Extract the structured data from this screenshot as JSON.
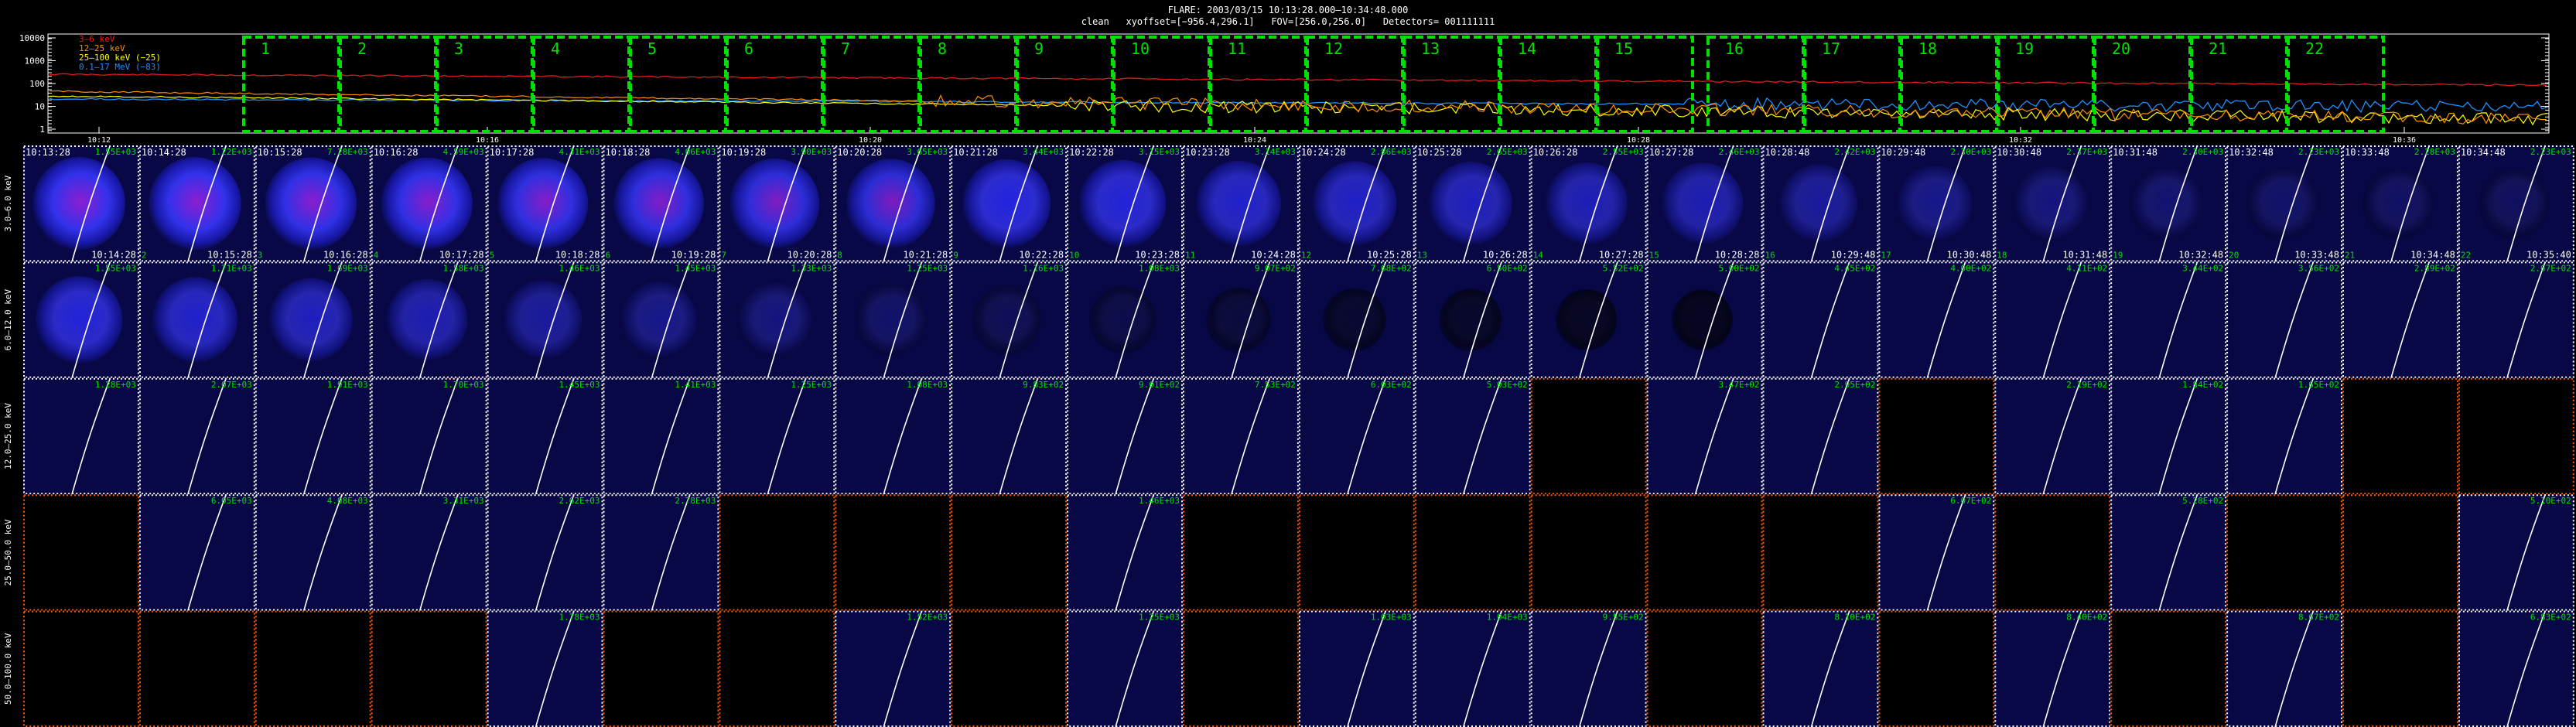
{
  "header": {
    "line1": "FLARE: 2003/03/15 10:13:28.000–10:34:48.000",
    "line2": "clean   xyoffset=[−956.4,296.1]   FOV=[256.0,256.0]   Detectors= 001111111"
  },
  "lightcurve": {
    "yticks": [
      "10000",
      "1000",
      "100",
      "10",
      "1"
    ],
    "xticks": [
      "10:12",
      "10:16",
      "10:20",
      "10:24",
      "10:28",
      "10:32",
      "10:36"
    ],
    "legend": [
      {
        "label": "3–6 keV",
        "color": "#e31a1a"
      },
      {
        "label": "12–25 keV",
        "color": "#ff8c00"
      },
      {
        "label": "25–100 keV (−25)",
        "color": "#ffff00"
      },
      {
        "label": "0.1–17 MeV (−83)",
        "color": "#1e90ff"
      }
    ],
    "intervals": [
      "1",
      "2",
      "3",
      "4",
      "5",
      "6",
      "7",
      "8",
      "9",
      "10",
      "11",
      "12",
      "13",
      "14",
      "15",
      "16",
      "17",
      "18",
      "19",
      "20",
      "21",
      "22"
    ],
    "colors": {
      "box": "#00e000",
      "red": "#e31a1a",
      "orange": "#ff8c00",
      "yellow": "#ffff00",
      "blue": "#1e90ff"
    }
  },
  "rows": [
    {
      "label": "3.0–6.0 keV",
      "cells": [
        {
          "start": "10:13:28",
          "end": "10:14:28",
          "value": "1.55E+03",
          "num": "",
          "brightness": 1.0,
          "purple": 1,
          "frame": "white"
        },
        {
          "start": "10:14:28",
          "end": "10:15:28",
          "value": "1.22E+03",
          "num": "2",
          "brightness": 1.0,
          "purple": 1,
          "frame": "white"
        },
        {
          "start": "10:15:28",
          "end": "10:16:28",
          "value": "7.28E+03",
          "num": "3",
          "brightness": 0.98,
          "purple": 1,
          "frame": "white"
        },
        {
          "start": "10:16:28",
          "end": "10:17:28",
          "value": "4.59E+03",
          "num": "4",
          "brightness": 0.97,
          "purple": 1,
          "frame": "white"
        },
        {
          "start": "10:17:28",
          "end": "10:18:28",
          "value": "4.31E+03",
          "num": "5",
          "brightness": 0.95,
          "purple": 1,
          "frame": "white"
        },
        {
          "start": "10:18:28",
          "end": "10:19:28",
          "value": "4.06E+03",
          "num": "6",
          "brightness": 0.94,
          "purple": 1,
          "frame": "white"
        },
        {
          "start": "10:19:28",
          "end": "10:20:28",
          "value": "3.90E+03",
          "num": "7",
          "brightness": 0.92,
          "purple": 1,
          "frame": "white"
        },
        {
          "start": "10:20:28",
          "end": "10:21:28",
          "value": "3.65E+03",
          "num": "8",
          "brightness": 0.9,
          "purple": 1,
          "frame": "white"
        },
        {
          "start": "10:21:28",
          "end": "10:22:28",
          "value": "3.44E+03",
          "num": "9",
          "brightness": 0.88,
          "purple": 0,
          "frame": "white"
        },
        {
          "start": "10:22:28",
          "end": "10:23:28",
          "value": "3.15E+03",
          "num": "10",
          "brightness": 0.85,
          "purple": 0,
          "frame": "white"
        },
        {
          "start": "10:23:28",
          "end": "10:24:28",
          "value": "3.14E+03",
          "num": "11",
          "brightness": 0.8,
          "purple": 0,
          "frame": "white"
        },
        {
          "start": "10:24:28",
          "end": "10:25:28",
          "value": "2.86E+03",
          "num": "12",
          "brightness": 0.78,
          "purple": 0,
          "frame": "white"
        },
        {
          "start": "10:25:28",
          "end": "10:26:28",
          "value": "2.65E+03",
          "num": "13",
          "brightness": 0.75,
          "purple": 0,
          "frame": "white"
        },
        {
          "start": "10:26:28",
          "end": "10:27:28",
          "value": "2.55E+03",
          "num": "14",
          "brightness": 0.72,
          "purple": 0,
          "frame": "white"
        },
        {
          "start": "10:27:28",
          "end": "10:28:28",
          "value": "2.46E+03",
          "num": "15",
          "brightness": 0.7,
          "purple": 0,
          "frame": "white"
        },
        {
          "start": "10:28:48",
          "end": "10:29:48",
          "value": "2.42E+03",
          "num": "16",
          "brightness": 0.62,
          "purple": 0,
          "frame": "white"
        },
        {
          "start": "10:29:48",
          "end": "10:30:48",
          "value": "2.30E+03",
          "num": "17",
          "brightness": 0.55,
          "purple": 0,
          "frame": "white"
        },
        {
          "start": "10:30:48",
          "end": "10:31:48",
          "value": "2.37E+03",
          "num": "18",
          "brightness": 0.5,
          "purple": 0,
          "frame": "white"
        },
        {
          "start": "10:31:48",
          "end": "10:32:48",
          "value": "2.30E+03",
          "num": "19",
          "brightness": 0.45,
          "purple": 0,
          "frame": "white"
        },
        {
          "start": "10:32:48",
          "end": "10:33:48",
          "value": "2.23E+03",
          "num": "20",
          "brightness": 0.42,
          "purple": 0,
          "frame": "white"
        },
        {
          "start": "10:33:48",
          "end": "10:34:48",
          "value": "2.28E+03",
          "num": "21",
          "brightness": 0.4,
          "purple": 0,
          "frame": "white"
        },
        {
          "start": "10:34:48",
          "end": "10:35:40",
          "value": "2.23E+03",
          "num": "22",
          "brightness": 0.38,
          "purple": 0,
          "frame": "white"
        }
      ]
    },
    {
      "label": "6.0–12.0 keV",
      "cells": [
        {
          "value": "1.55E+03",
          "brightness": 0.85,
          "frame": "white"
        },
        {
          "value": "1.71E+03",
          "brightness": 0.8,
          "frame": "white"
        },
        {
          "value": "1.69E+03",
          "brightness": 0.75,
          "frame": "white"
        },
        {
          "value": "1.58E+03",
          "brightness": 0.7,
          "frame": "white"
        },
        {
          "value": "1.46E+03",
          "brightness": 0.62,
          "frame": "white"
        },
        {
          "value": "1.45E+03",
          "brightness": 0.55,
          "frame": "white"
        },
        {
          "value": "1.33E+03",
          "brightness": 0.5,
          "frame": "white"
        },
        {
          "value": "1.25E+03",
          "brightness": 0.42,
          "frame": "white"
        },
        {
          "value": "1.16E+03",
          "brightness": 0.35,
          "frame": "white"
        },
        {
          "value": "1.08E+03",
          "brightness": 0.3,
          "frame": "white"
        },
        {
          "value": "9.07E+02",
          "brightness": 0.25,
          "frame": "white"
        },
        {
          "value": "7.68E+02",
          "brightness": 0.2,
          "frame": "white"
        },
        {
          "value": "6.50E+02",
          "brightness": 0.18,
          "frame": "white"
        },
        {
          "value": "5.52E+02",
          "brightness": 0.15,
          "frame": "white"
        },
        {
          "value": "5.00E+02",
          "brightness": 0.14,
          "frame": "white"
        },
        {
          "value": "4.45E+02",
          "brightness": 0.13,
          "frame": "white"
        },
        {
          "value": "4.00E+02",
          "brightness": 0.12,
          "frame": "white"
        },
        {
          "value": "4.11E+02",
          "brightness": 0.12,
          "frame": "white"
        },
        {
          "value": "3.44E+02",
          "brightness": 0.11,
          "frame": "white"
        },
        {
          "value": "3.56E+02",
          "brightness": 0.11,
          "frame": "white"
        },
        {
          "value": "2.89E+02",
          "brightness": 0.1,
          "frame": "white"
        },
        {
          "value": "2.67E+02",
          "brightness": 0.1,
          "frame": "white"
        }
      ]
    },
    {
      "label": "12.0–25.0 keV",
      "cells": [
        {
          "value": "1.28E+03",
          "brightness": 0.12,
          "frame": "white"
        },
        {
          "value": "2.07E+03",
          "brightness": 0.12,
          "frame": "white"
        },
        {
          "value": "1.91E+03",
          "brightness": 0.12,
          "frame": "white"
        },
        {
          "value": "1.70E+03",
          "brightness": 0.11,
          "frame": "white"
        },
        {
          "value": "1.45E+03",
          "brightness": 0.11,
          "frame": "white"
        },
        {
          "value": "1.41E+03",
          "brightness": 0.11,
          "frame": "white"
        },
        {
          "value": "1.25E+03",
          "brightness": 0.1,
          "frame": "white"
        },
        {
          "value": "1.08E+03",
          "brightness": 0.1,
          "frame": "white"
        },
        {
          "value": "9.83E+02",
          "brightness": 0.1,
          "frame": "white"
        },
        {
          "value": "9.01E+02",
          "brightness": 0.1,
          "frame": "white"
        },
        {
          "value": "7.53E+02",
          "brightness": 0.1,
          "frame": "white"
        },
        {
          "value": "6.03E+02",
          "brightness": 0.1,
          "frame": "white"
        },
        {
          "value": "5.03E+02",
          "brightness": 0.1,
          "frame": "white"
        },
        {
          "value": "",
          "brightness": 0,
          "frame": "orange"
        },
        {
          "value": "3.47E+02",
          "brightness": 0.1,
          "frame": "white"
        },
        {
          "value": "2.95E+02",
          "brightness": 0.1,
          "frame": "white"
        },
        {
          "value": "",
          "brightness": 0,
          "frame": "orange"
        },
        {
          "value": "2.19E+02",
          "brightness": 0.1,
          "frame": "white"
        },
        {
          "value": "1.84E+02",
          "brightness": 0.1,
          "frame": "white"
        },
        {
          "value": "1.65E+02",
          "brightness": 0.1,
          "frame": "white"
        },
        {
          "value": "",
          "brightness": 0,
          "frame": "orange"
        },
        {
          "value": "",
          "brightness": 0,
          "frame": "orange"
        }
      ]
    },
    {
      "label": "25.0–50.0 keV",
      "cells": [
        {
          "value": "",
          "brightness": 0,
          "frame": "orange"
        },
        {
          "value": "6.05E+03",
          "brightness": 0.1,
          "frame": "white"
        },
        {
          "value": "4.08E+03",
          "brightness": 0.1,
          "frame": "white"
        },
        {
          "value": "3.31E+03",
          "brightness": 0.1,
          "frame": "white"
        },
        {
          "value": "2.62E+03",
          "brightness": 0.1,
          "frame": "white"
        },
        {
          "value": "2.78E+03",
          "brightness": 0.1,
          "frame": "white"
        },
        {
          "value": "",
          "brightness": 0,
          "frame": "orange"
        },
        {
          "value": "",
          "brightness": 0,
          "frame": "orange"
        },
        {
          "value": "",
          "brightness": 0,
          "frame": "orange"
        },
        {
          "value": "1.46E+03",
          "brightness": 0.1,
          "frame": "white"
        },
        {
          "value": "",
          "brightness": 0,
          "frame": "orange"
        },
        {
          "value": "",
          "brightness": 0,
          "frame": "orange"
        },
        {
          "value": "",
          "brightness": 0,
          "frame": "orange"
        },
        {
          "value": "",
          "brightness": 0,
          "frame": "orange"
        },
        {
          "value": "",
          "brightness": 0,
          "frame": "orange"
        },
        {
          "value": "",
          "brightness": 0,
          "frame": "orange"
        },
        {
          "value": "6.07E+02",
          "brightness": 0.1,
          "frame": "white"
        },
        {
          "value": "",
          "brightness": 0,
          "frame": "orange"
        },
        {
          "value": "5.28E+02",
          "brightness": 0.1,
          "frame": "white"
        },
        {
          "value": "",
          "brightness": 0,
          "frame": "orange"
        },
        {
          "value": "",
          "brightness": 0,
          "frame": "orange"
        },
        {
          "value": "5.10E+02",
          "brightness": 0.1,
          "frame": "white"
        }
      ]
    },
    {
      "label": "50.0–100.0 keV",
      "cells": [
        {
          "value": "",
          "brightness": 0,
          "frame": "orange"
        },
        {
          "value": "",
          "brightness": 0,
          "frame": "orange"
        },
        {
          "value": "",
          "brightness": 0,
          "frame": "orange"
        },
        {
          "value": "",
          "brightness": 0,
          "frame": "orange"
        },
        {
          "value": "1.78E+03",
          "brightness": 0.1,
          "frame": "white"
        },
        {
          "value": "",
          "brightness": 0,
          "frame": "orange"
        },
        {
          "value": "",
          "brightness": 0,
          "frame": "orange"
        },
        {
          "value": "1.52E+03",
          "brightness": 0.1,
          "frame": "white"
        },
        {
          "value": "",
          "brightness": 0,
          "frame": "orange"
        },
        {
          "value": "1.25E+03",
          "brightness": 0.1,
          "frame": "white"
        },
        {
          "value": "",
          "brightness": 0,
          "frame": "orange"
        },
        {
          "value": "1.03E+03",
          "brightness": 0.1,
          "frame": "white"
        },
        {
          "value": "1.04E+03",
          "brightness": 0.1,
          "frame": "white"
        },
        {
          "value": "9.55E+02",
          "brightness": 0.1,
          "frame": "white"
        },
        {
          "value": "",
          "brightness": 0,
          "frame": "orange"
        },
        {
          "value": "8.10E+02",
          "brightness": 0.1,
          "frame": "white"
        },
        {
          "value": "",
          "brightness": 0,
          "frame": "orange"
        },
        {
          "value": "8.40E+02",
          "brightness": 0.1,
          "frame": "white"
        },
        {
          "value": "",
          "brightness": 0,
          "frame": "orange"
        },
        {
          "value": "8.67E+02",
          "brightness": 0.1,
          "frame": "white"
        },
        {
          "value": "",
          "brightness": 0,
          "frame": "orange"
        },
        {
          "value": "6.83E+02",
          "brightness": 0.1,
          "frame": "white"
        }
      ]
    }
  ]
}
